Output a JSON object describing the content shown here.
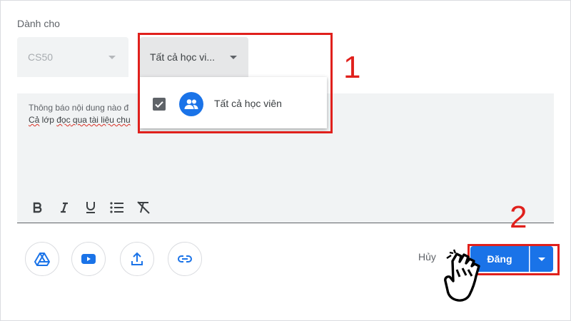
{
  "audience": {
    "label": "Dành cho",
    "class_value": "CS50",
    "students_value": "Tất cả học vi...",
    "menu": [
      {
        "label": "Tất cả học viên",
        "checked": true,
        "icon": "people-icon"
      }
    ]
  },
  "editor": {
    "placeholder": "Thông báo nội dung nào đ",
    "line2_prefix": "Cả",
    "line2_mid": " lớp ",
    "line2_word": "đọc",
    "line2_rest": " qua tài liệu chu",
    "format_buttons": [
      "bold-icon",
      "italic-icon",
      "underline-icon",
      "bulleted-list-icon",
      "clear-format-icon"
    ]
  },
  "attachments": [
    "google-drive-icon",
    "youtube-icon",
    "upload-icon",
    "link-icon"
  ],
  "actions": {
    "cancel_label": "Hủy",
    "post_label": "Đăng"
  },
  "annotations": {
    "step1": "1",
    "step2": "2",
    "highlight_color": "#e0201c"
  },
  "colors": {
    "accent": "#1a73e8",
    "field_bg": "#f1f3f4"
  }
}
